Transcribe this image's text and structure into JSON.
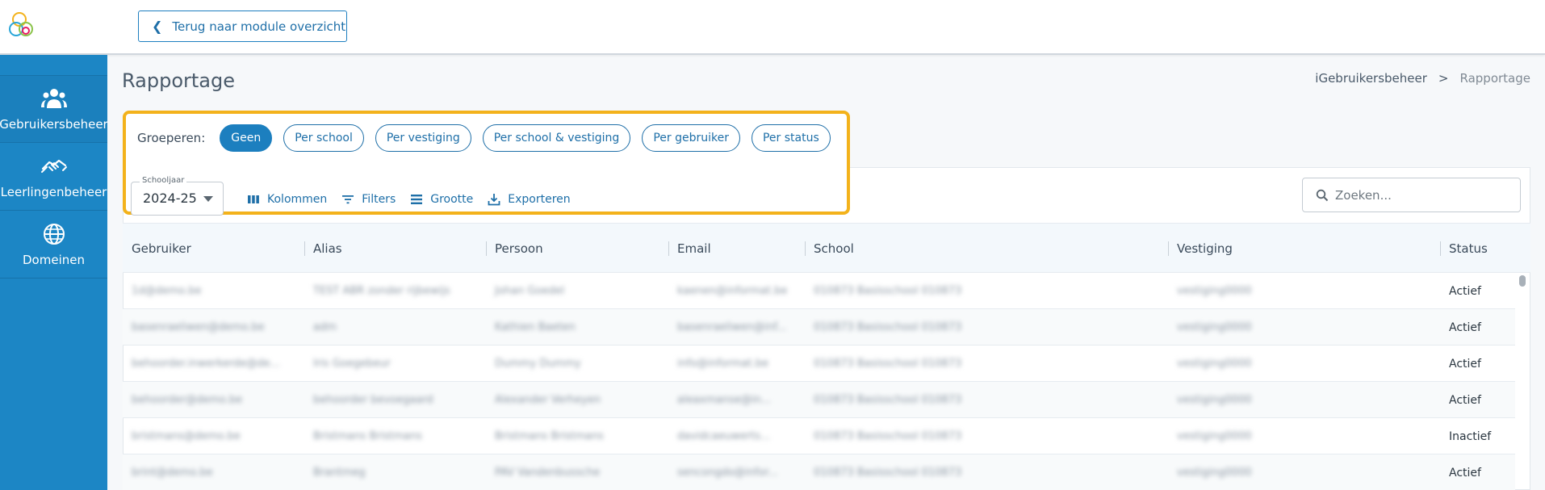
{
  "header": {
    "back_label": "Terug naar module overzicht"
  },
  "sidebar": {
    "items": [
      {
        "label": "Gebruikersbeheer",
        "icon": "users-icon"
      },
      {
        "label": "Leerlingenbeheer",
        "icon": "handshake-icon"
      },
      {
        "label": "Domeinen",
        "icon": "globe-icon"
      }
    ]
  },
  "page": {
    "title": "Rapportage",
    "breadcrumb": [
      "iGebruikersbeheer",
      ">",
      "Rapportage"
    ]
  },
  "grouping": {
    "label": "Groeperen:",
    "options": [
      "Geen",
      "Per school",
      "Per vestiging",
      "Per school & vestiging",
      "Per gebruiker",
      "Per status"
    ],
    "selected": "Geen"
  },
  "filters": {
    "schoolyear_label": "Schooljaar",
    "schoolyear_value": "2024-25"
  },
  "toolbar": {
    "columns_label": "Kolommen",
    "filters_label": "Filters",
    "size_label": "Grootte",
    "export_label": "Exporteren"
  },
  "search": {
    "placeholder": "Zoeken..."
  },
  "table": {
    "headers": [
      "Gebruiker",
      "Alias",
      "Persoon",
      "Email",
      "School",
      "Vestiging",
      "Status"
    ],
    "rows": [
      [
        "1d@demo.be",
        "TEST ABR zonder rijbewijs",
        "Johan Goedel",
        "kaenen@informat.be",
        "010873 Basisschool 010873",
        "vestiging0000",
        "Actief"
      ],
      [
        "basenraeliwen@demo.be",
        "adm",
        "Kathien Baeten",
        "basenraeliwen@inf...",
        "010873 Basisschool 010873",
        "vestiging0000",
        "Actief"
      ],
      [
        "behoorder.inwerkerde@de...",
        "Iris Goegebeur",
        "Dummy Dummy",
        "info@informat.be",
        "010873 Basisschool 010873",
        "vestiging0000",
        "Actief"
      ],
      [
        "behoorder@demo.be",
        "behoorder bevoegaard",
        "Alexander Verheyen",
        "aleaxmanse@in...",
        "010873 Basisschool 010873",
        "vestiging0000",
        "Actief"
      ],
      [
        "bristmans@demo.be",
        "Bristmans Bristmans",
        "Bristmans Bristmans",
        "davidcaeuwerts...",
        "010873 Basisschool 010873",
        "vestiging0000",
        "Inactief"
      ],
      [
        "brint@demo.be",
        "Brantmeg",
        "PAV Vandenbussche",
        "sencongdo@infor...",
        "010873 Basisschool 010873",
        "vestiging0000",
        "Actief"
      ]
    ]
  },
  "colors": {
    "brand": "#1c86c5",
    "accent": "#1e6fa8",
    "highlight": "#f3b21b"
  }
}
